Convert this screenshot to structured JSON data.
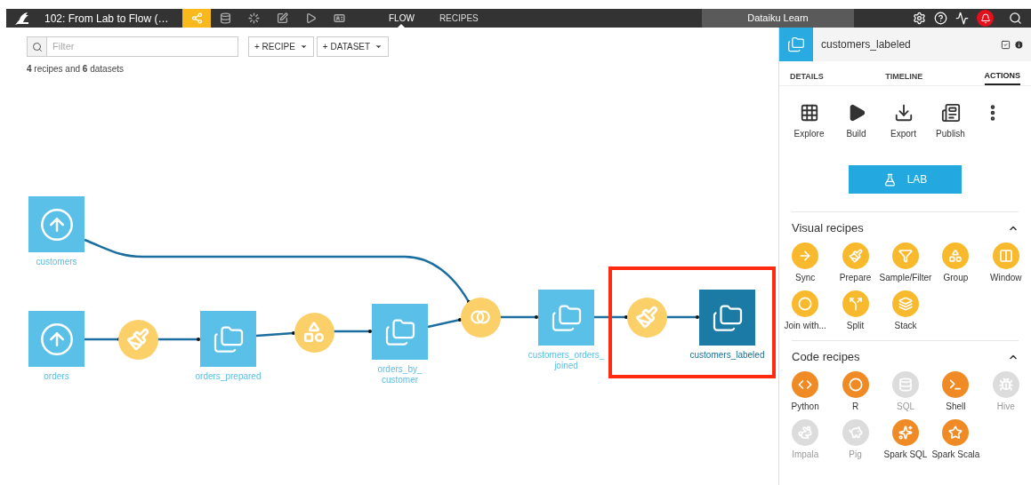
{
  "topbar": {
    "project_title": "102: From Lab to Flow (…",
    "nav_icons": [
      {
        "kind": "flow",
        "selected": true
      },
      {
        "kind": "datasets",
        "selected": false
      },
      {
        "kind": "jobs",
        "selected": false
      },
      {
        "kind": "notebooks",
        "selected": false
      },
      {
        "kind": "scenarios",
        "selected": false
      },
      {
        "kind": "dashboards",
        "selected": false
      }
    ],
    "tabs": [
      {
        "label": "FLOW",
        "selected": true
      },
      {
        "label": "RECIPES",
        "selected": false
      }
    ],
    "instance": "Dataiku Learn",
    "notifications_alert": true
  },
  "toolbar": {
    "filter": {
      "placeholder": "Filter"
    },
    "buttons": [
      "+ RECIPE",
      "+ DATASET"
    ],
    "summary": "**4** recipes and **6** datasets"
  },
  "flow": {
    "highlight_frame": true,
    "nodes": [
      {
        "kind": "uploaded_dataset",
        "label": "customers",
        "selected": false
      },
      {
        "kind": "uploaded_dataset",
        "label": "orders",
        "selected": false
      },
      {
        "kind": "prepare_recipe",
        "selected": false
      },
      {
        "kind": "managed_dataset",
        "label": "orders_prepared",
        "selected": false
      },
      {
        "kind": "group_recipe",
        "selected": false
      },
      {
        "kind": "managed_dataset",
        "label": "orders_by_customer",
        "selected": false
      },
      {
        "kind": "join_recipe",
        "selected": false
      },
      {
        "kind": "managed_dataset",
        "label": "customers_orders_joined",
        "selected": false
      },
      {
        "kind": "prepare_recipe",
        "selected": false
      },
      {
        "kind": "managed_dataset",
        "label": "customers_labeled",
        "selected": true
      }
    ]
  },
  "panel": {
    "title": "customers_labeled",
    "tabs": [
      {
        "label": "DETAILS",
        "selected": false
      },
      {
        "label": "TIMELINE",
        "selected": false
      },
      {
        "label": "ACTIONS",
        "selected": true
      }
    ],
    "actions": [
      {
        "kind": "explore",
        "label": "Explore"
      },
      {
        "kind": "build",
        "label": "Build"
      },
      {
        "kind": "export",
        "label": "Export"
      },
      {
        "kind": "publish",
        "label": "Publish"
      }
    ],
    "lab_button": "LAB",
    "sections": [
      {
        "title": "Visual recipes",
        "expanded": true,
        "items": [
          {
            "kind": "sync",
            "label": "Sync",
            "enabled": true
          },
          {
            "kind": "prepare",
            "label": "Prepare",
            "enabled": true
          },
          {
            "kind": "filter",
            "label": "Sample/Filter",
            "enabled": true
          },
          {
            "kind": "group",
            "label": "Group",
            "enabled": true
          },
          {
            "kind": "window",
            "label": "Window",
            "enabled": true
          },
          {
            "kind": "join",
            "label": "Join with...",
            "enabled": true
          },
          {
            "kind": "split",
            "label": "Split",
            "enabled": true
          },
          {
            "kind": "stack",
            "label": "Stack",
            "enabled": true
          }
        ]
      },
      {
        "title": "Code recipes",
        "expanded": true,
        "items": [
          {
            "kind": "python",
            "label": "Python",
            "enabled": true
          },
          {
            "kind": "r",
            "label": "R",
            "enabled": true
          },
          {
            "kind": "sql",
            "label": "SQL",
            "enabled": false
          },
          {
            "kind": "shell",
            "label": "Shell",
            "enabled": true
          },
          {
            "kind": "hive",
            "label": "Hive",
            "enabled": false
          },
          {
            "kind": "impala",
            "label": "Impala",
            "enabled": false
          },
          {
            "kind": "pig",
            "label": "Pig",
            "enabled": false
          },
          {
            "kind": "spark_sql",
            "label": "Spark SQL",
            "enabled": true
          },
          {
            "kind": "spark_scala",
            "label": "Spark Scala",
            "enabled": true
          }
        ]
      }
    ]
  }
}
